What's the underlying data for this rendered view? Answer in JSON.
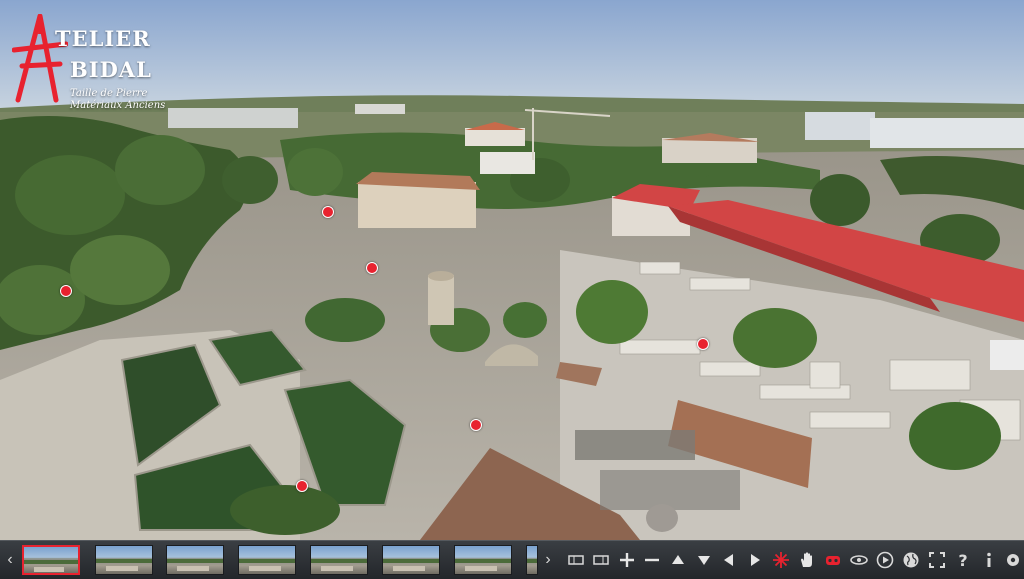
{
  "logo": {
    "line1": "TELIER",
    "line2": "BIDAL",
    "tagline1": "Taille de Pierre",
    "tagline2": "Matériaux Anciens",
    "accent": "#e8222f"
  },
  "hotspots": [
    {
      "name": "hotspot-villa"
    },
    {
      "name": "hotspot-garden-path"
    },
    {
      "name": "hotspot-left-garden"
    },
    {
      "name": "hotspot-stone-yard"
    },
    {
      "name": "hotspot-central-path"
    },
    {
      "name": "hotspot-lower-garden"
    }
  ],
  "toolbar": {
    "prev_icon": "chevron-left-icon",
    "next_icon": "chevron-right-icon",
    "thumbnail_count": 7,
    "active_thumbnail": 0,
    "buttons": [
      "thumbnails-view-icon",
      "thumbnails-list-icon",
      "zoom-in-icon",
      "zoom-out-icon",
      "pan-up-icon",
      "pan-down-icon",
      "pan-left-icon",
      "pan-right-icon",
      "autorotate-icon",
      "drag-hand-icon",
      "vr-headset-icon",
      "orbit-icon",
      "play-icon",
      "globe-icon",
      "fullscreen-icon",
      "help-icon",
      "info-icon",
      "hotspots-icon"
    ]
  },
  "colors": {
    "roof_red": "#d24545",
    "hotspot": "#e8222f",
    "toolbar_bg": "#2c2f33"
  }
}
